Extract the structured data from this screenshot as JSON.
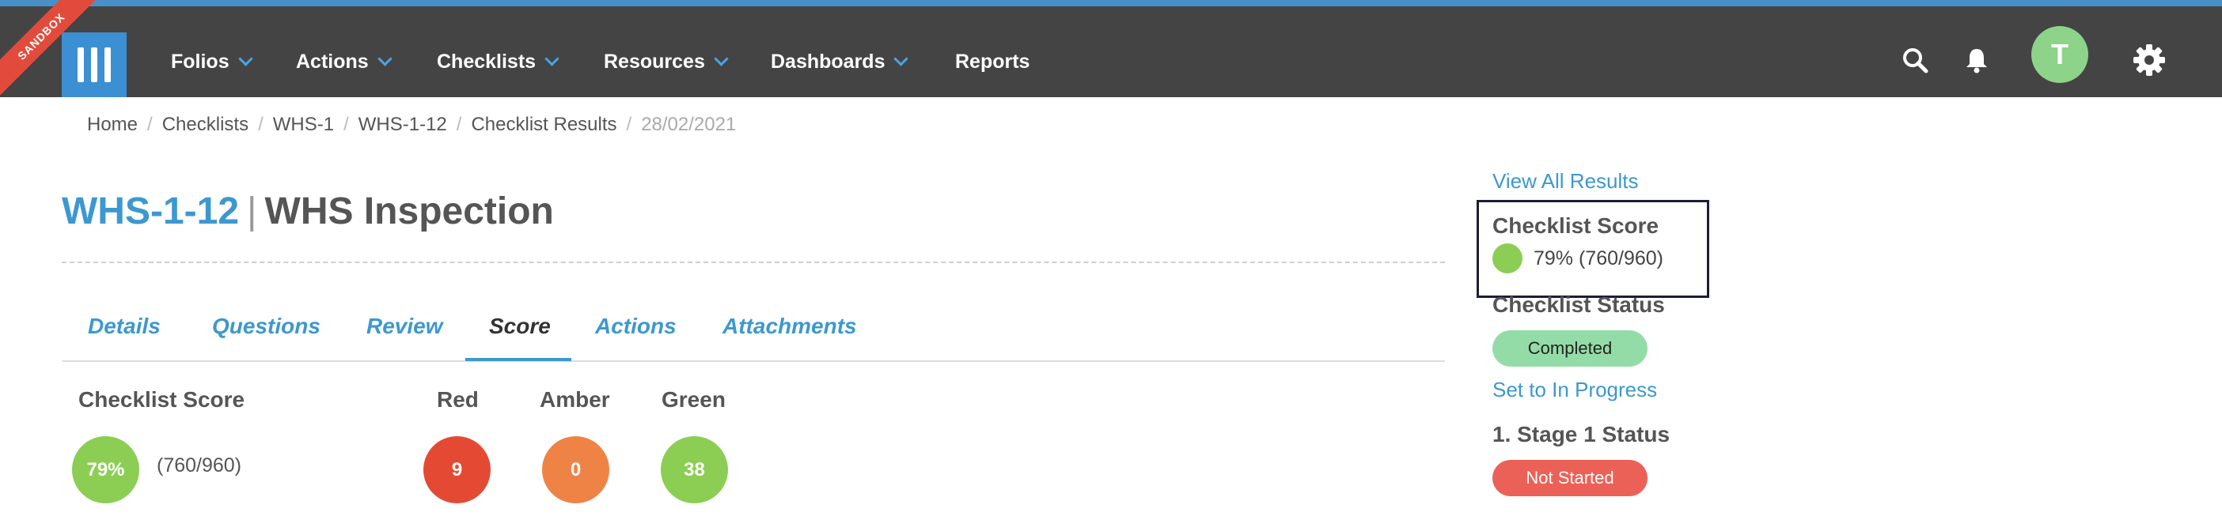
{
  "sandbox_label": "SANDBOX",
  "nav": {
    "items": [
      {
        "label": "Folios",
        "has_dropdown": true
      },
      {
        "label": "Actions",
        "has_dropdown": true
      },
      {
        "label": "Checklists",
        "has_dropdown": true
      },
      {
        "label": "Resources",
        "has_dropdown": true
      },
      {
        "label": "Dashboards",
        "has_dropdown": true
      },
      {
        "label": "Reports",
        "has_dropdown": false
      }
    ],
    "icons": [
      "search-icon",
      "bell-icon",
      "gear-icon"
    ],
    "avatar_initial": "T"
  },
  "breadcrumb": [
    "Home",
    "Checklists",
    "WHS-1",
    "WHS-1-12",
    "Checklist Results",
    "28/02/2021"
  ],
  "title": {
    "code": "WHS-1-12",
    "separator": "|",
    "name": "WHS Inspection"
  },
  "tabs": [
    {
      "label": "Details",
      "active": false
    },
    {
      "label": "Questions",
      "active": false
    },
    {
      "label": "Review",
      "active": false
    },
    {
      "label": "Score",
      "active": true
    },
    {
      "label": "Actions",
      "active": false
    },
    {
      "label": "Attachments",
      "active": false
    }
  ],
  "score": {
    "heading": "Checklist Score",
    "percent": "79%",
    "fraction": "(760/960)",
    "red": {
      "label": "Red",
      "value": "9"
    },
    "amber": {
      "label": "Amber",
      "value": "0"
    },
    "green": {
      "label": "Green",
      "value": "38"
    }
  },
  "sidebar": {
    "view_all": "View All Results",
    "score_heading": "Checklist Score",
    "score_value": "79% (760/960)",
    "status_heading": "Checklist Status",
    "status_value": "Completed",
    "set_status_link": "Set to In Progress",
    "stage_heading": "1. Stage 1 Status",
    "stage_status": "Not Started"
  },
  "colors": {
    "navbar": "#444444",
    "accent": "#3d98cf",
    "score_green": "#8ccd53",
    "red": "#e44a33",
    "amber": "#ef8346",
    "green": "#8ccd53",
    "completed_pill": "#94dca7",
    "not_started_pill": "#ec6157"
  }
}
